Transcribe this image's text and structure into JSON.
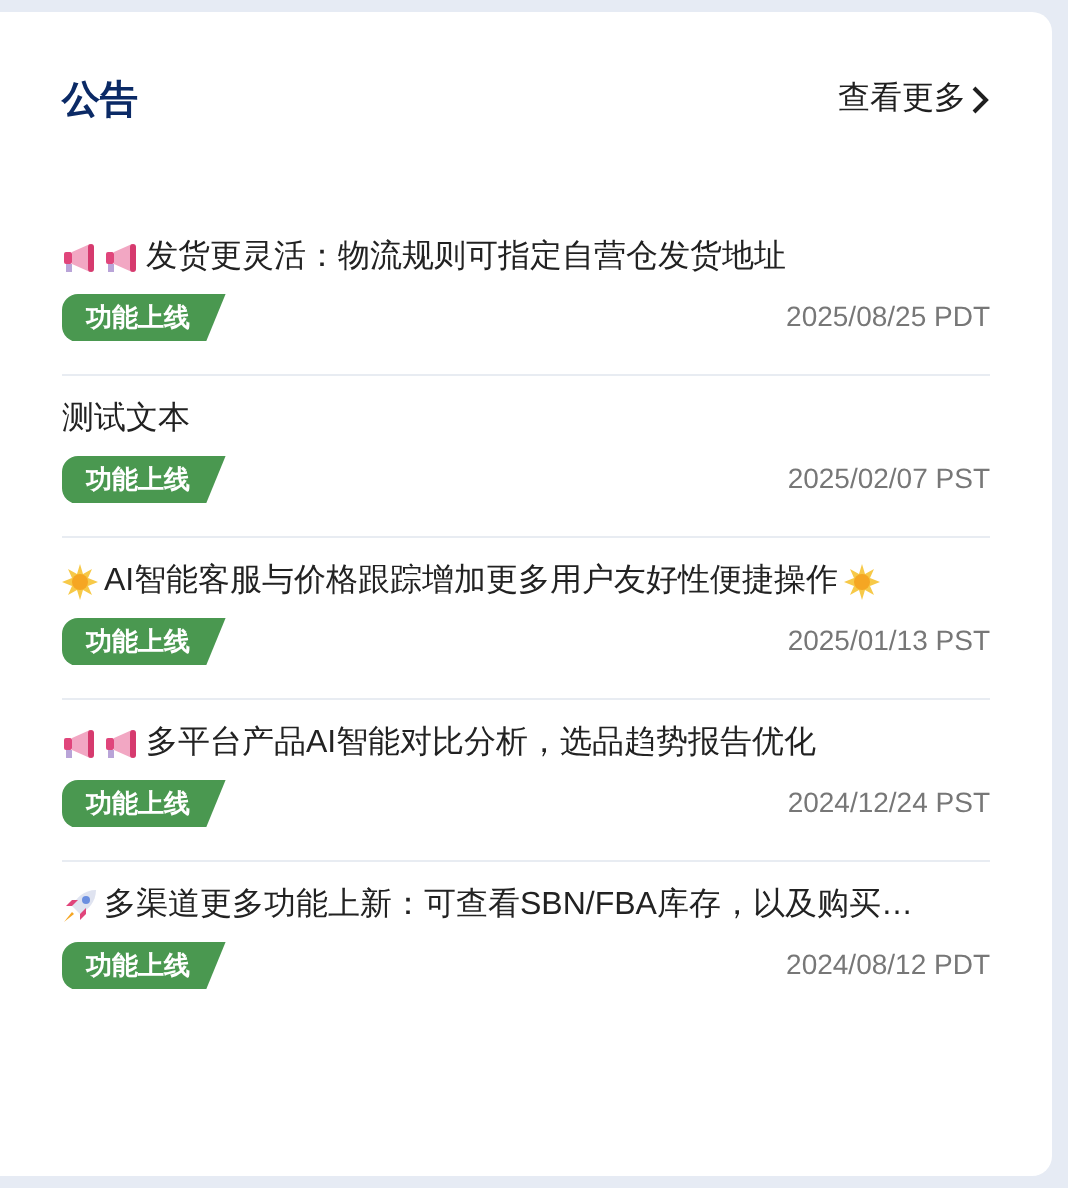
{
  "card": {
    "title": "公告",
    "more_link": "查看更多"
  },
  "items": [
    {
      "kind": "announcement",
      "title": "发货更灵活：物流规则可指定自营仓发货地址",
      "tag": "功能上线",
      "date": "2025/08/25 PDT"
    },
    {
      "kind": "plain",
      "title": "测试文本",
      "tag": "功能上线",
      "date": "2025/02/07 PST"
    },
    {
      "kind": "highlight",
      "title": "AI智能客服与价格跟踪增加更多用户友好性便捷操作",
      "tag": "功能上线",
      "date": "2025/01/13 PST"
    },
    {
      "kind": "announcement",
      "title": "多平台产品AI智能对比分析，选品趋势报告优化",
      "tag": "功能上线",
      "date": "2024/12/24 PST"
    },
    {
      "kind": "launch",
      "title": "多渠道更多功能上新：可查看SBN/FBA库存，以及购买…",
      "tag": "功能上线",
      "date": "2024/08/12 PDT"
    }
  ]
}
